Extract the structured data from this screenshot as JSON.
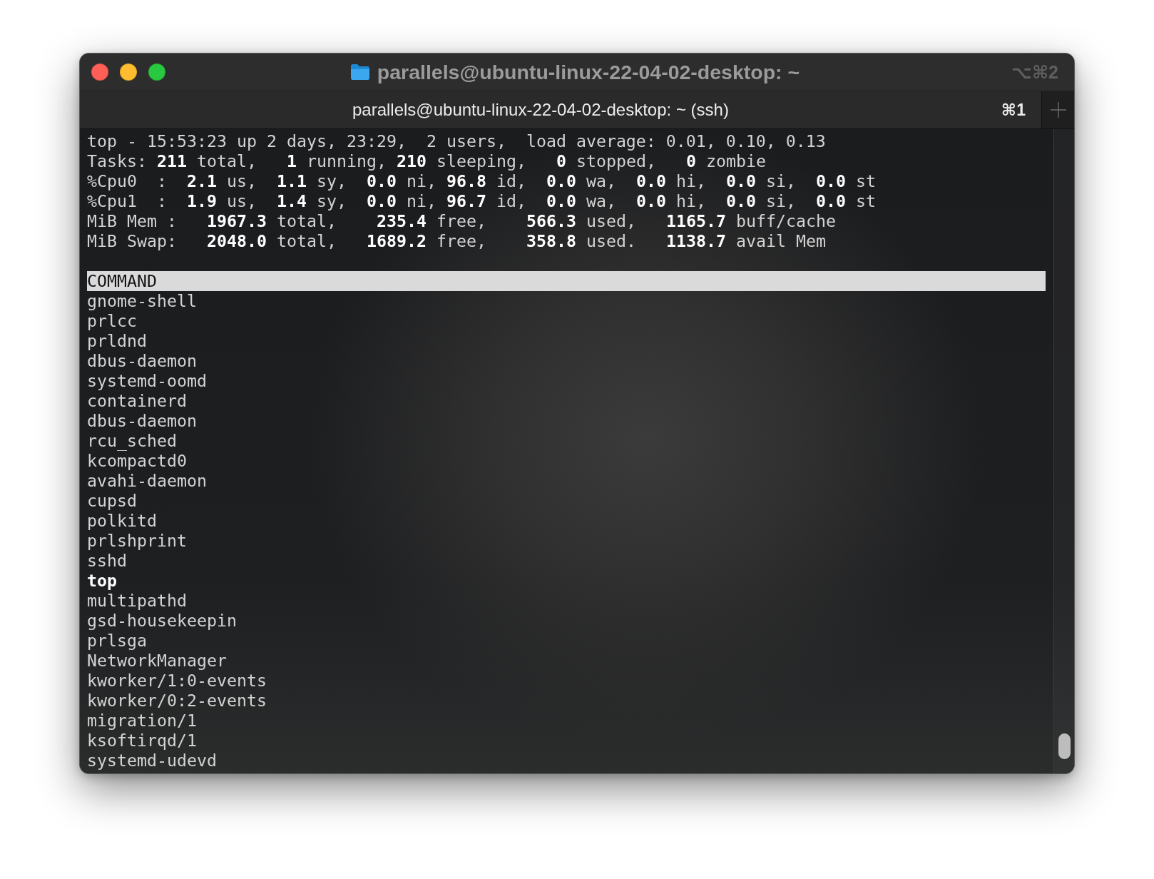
{
  "window": {
    "title": "parallels@ubuntu-linux-22-04-02-desktop: ~",
    "shortcut": "⌥⌘2"
  },
  "tabs": [
    {
      "label": "parallels@ubuntu-linux-22-04-02-desktop: ~ (ssh)",
      "shortcut": "⌘1",
      "selected": true
    }
  ],
  "terminal": {
    "summary_lines": [
      "top - 15:53:23 up 2 days, 23:29,  2 users,  load average: 0.01, 0.10, 0.13",
      "Tasks: **211** total,   **1** running, **210** sleeping,   **0** stopped,   **0** zombie",
      "%Cpu0  :  **2.1** us,  **1.1** sy,  **0.0** ni, **96.8** id,  **0.0** wa,  **0.0** hi,  **0.0** si,  **0.0** st",
      "%Cpu1  :  **1.9** us,  **1.4** sy,  **0.0** ni, **96.7** id,  **0.0** wa,  **0.0** hi,  **0.0** si,  **0.0** st",
      "MiB Mem :   **1967.3** total,    **235.4** free,    **566.3** used,   **1165.7** buff/cache",
      "MiB Swap:   **2048.0** total,   **1689.2** free,    **358.8** used.   **1138.7** avail Mem"
    ],
    "column_header": "COMMAND",
    "processes": [
      {
        "command": "gnome-shell",
        "highlighted": false
      },
      {
        "command": "prlcc",
        "highlighted": false
      },
      {
        "command": "prldnd",
        "highlighted": false
      },
      {
        "command": "dbus-daemon",
        "highlighted": false
      },
      {
        "command": "systemd-oomd",
        "highlighted": false
      },
      {
        "command": "containerd",
        "highlighted": false
      },
      {
        "command": "dbus-daemon",
        "highlighted": false
      },
      {
        "command": "rcu_sched",
        "highlighted": false
      },
      {
        "command": "kcompactd0",
        "highlighted": false
      },
      {
        "command": "avahi-daemon",
        "highlighted": false
      },
      {
        "command": "cupsd",
        "highlighted": false
      },
      {
        "command": "polkitd",
        "highlighted": false
      },
      {
        "command": "prlshprint",
        "highlighted": false
      },
      {
        "command": "sshd",
        "highlighted": false
      },
      {
        "command": "top",
        "highlighted": true
      },
      {
        "command": "multipathd",
        "highlighted": false
      },
      {
        "command": "gsd-housekeepin",
        "highlighted": false
      },
      {
        "command": "prlsga",
        "highlighted": false
      },
      {
        "command": "NetworkManager",
        "highlighted": false
      },
      {
        "command": "kworker/1:0-events",
        "highlighted": false
      },
      {
        "command": "kworker/0:2-events",
        "highlighted": false
      },
      {
        "command": "migration/1",
        "highlighted": false
      },
      {
        "command": "ksoftirqd/1",
        "highlighted": false
      },
      {
        "command": "systemd-udevd",
        "highlighted": false
      }
    ]
  }
}
